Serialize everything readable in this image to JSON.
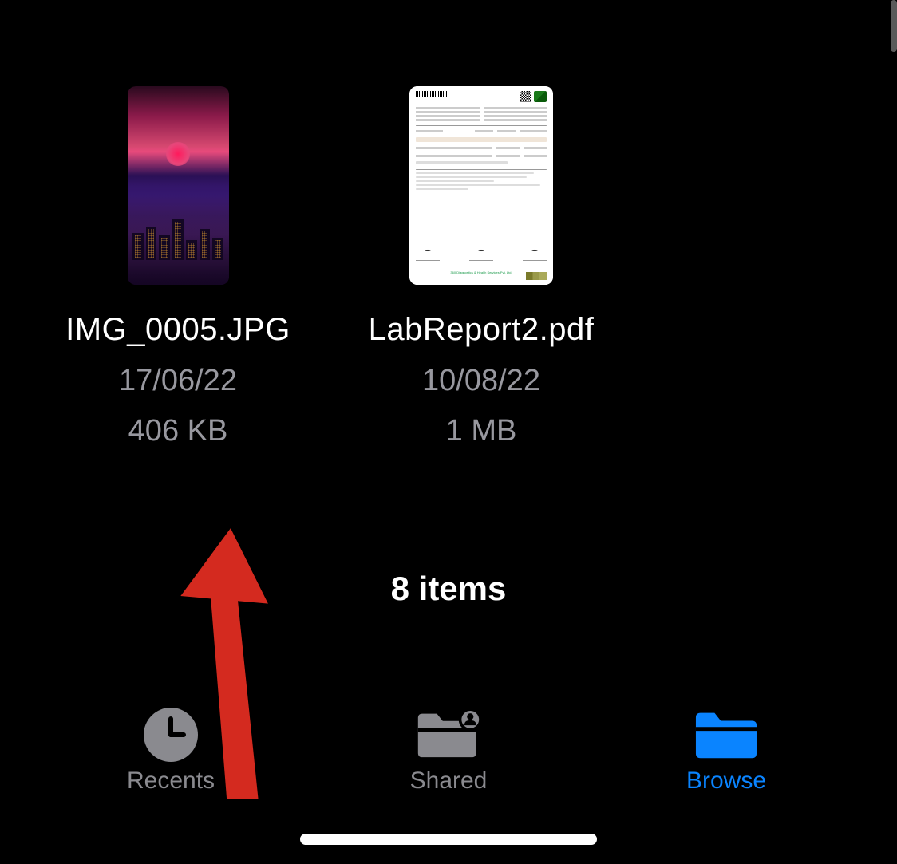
{
  "files": [
    {
      "name": "IMG_0005.JPG",
      "date": "17/06/22",
      "size": "406 KB"
    },
    {
      "name": "LabReport2.pdf",
      "date": "10/08/22",
      "size": "1 MB"
    }
  ],
  "summary": {
    "items_count_label": "8 items"
  },
  "tabs": {
    "recents": {
      "label": "Recents"
    },
    "shared": {
      "label": "Shared"
    },
    "browse": {
      "label": "Browse"
    }
  },
  "colors": {
    "accent": "#0a84ff",
    "inactive": "#8a8a8f",
    "annotation": "#d42a1f"
  }
}
